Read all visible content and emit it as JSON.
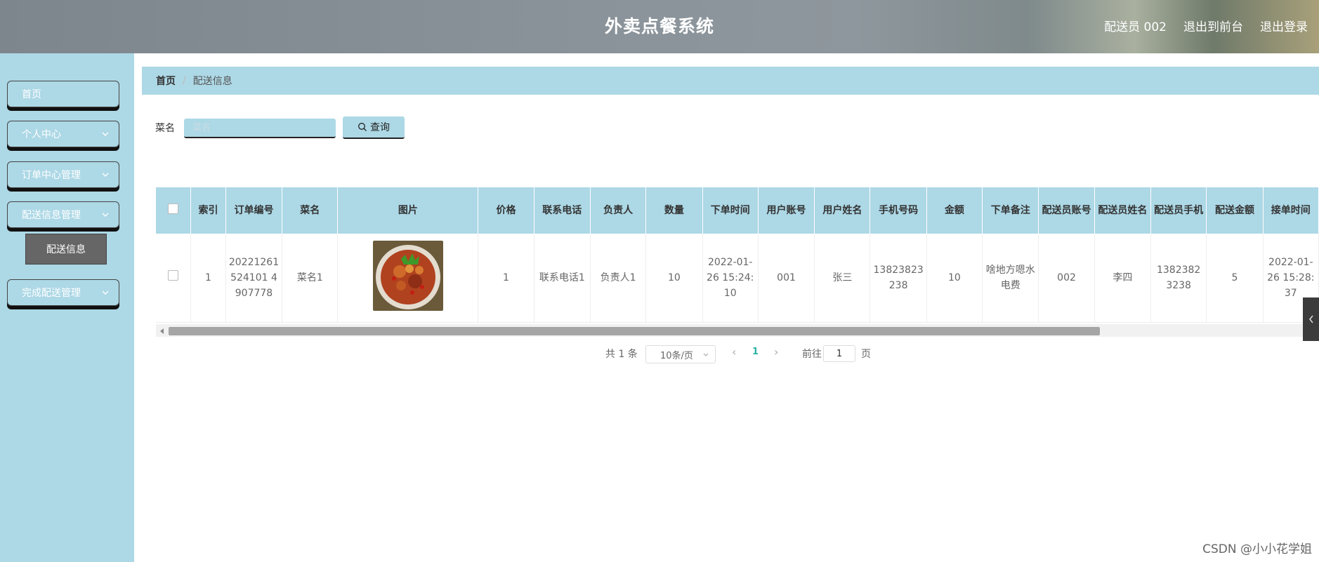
{
  "header": {
    "title": "外卖点餐系统",
    "user_label": "配送员 002",
    "link_front": "退出到前台",
    "link_logout": "退出登录"
  },
  "sidebar": {
    "items": [
      {
        "label": "首页",
        "has_children": false
      },
      {
        "label": "个人中心",
        "has_children": true
      },
      {
        "label": "订单中心管理",
        "has_children": true
      },
      {
        "label": "配送信息管理",
        "has_children": true,
        "expanded": true
      },
      {
        "label": "完成配送管理",
        "has_children": true
      }
    ],
    "sub_item": "配送信息"
  },
  "breadcrumb": {
    "home": "首页",
    "separator": "/",
    "current": "配送信息"
  },
  "search": {
    "label": "菜名",
    "placeholder": "菜名",
    "value": "",
    "button_label": "查询"
  },
  "table": {
    "columns": [
      "索引",
      "订单编号",
      "菜名",
      "图片",
      "价格",
      "联系电话",
      "负责人",
      "数量",
      "下单时间",
      "用户账号",
      "用户姓名",
      "手机号码",
      "金额",
      "下单备注",
      "配送员账号",
      "配送员姓名",
      "配送员手机",
      "配送金额",
      "接单时间"
    ],
    "rows": [
      {
        "index": "1",
        "order_no": "20221261524101 4907778",
        "dish": "菜名1",
        "price": "1",
        "phone": "联系电话1",
        "manager": "负责人1",
        "quantity": "10",
        "order_time": "2022-01-26 15:24:10",
        "user_account": "001",
        "user_name": "张三",
        "mobile": "13823823238",
        "amount": "10",
        "note": "啥地方嗯水电费",
        "courier_account": "002",
        "courier_name": "李四",
        "courier_mobile": "13823823238",
        "delivery_amount": "5",
        "accept_time": "2022-01-26 15:28:37"
      }
    ]
  },
  "pagination": {
    "total_text": "共 1 条",
    "page_size": "10条/页",
    "current_page": "1",
    "goto_label": "前往",
    "goto_value": "1",
    "goto_unit": "页"
  },
  "watermark": "CSDN @小小花学姐",
  "colors": {
    "accent": "#add8e6",
    "pager_active": "#2bb3a3"
  }
}
